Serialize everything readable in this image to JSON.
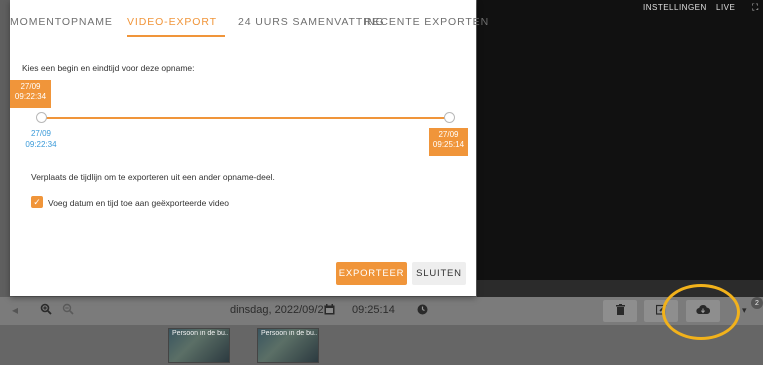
{
  "tabs": [
    {
      "label": "MOMENTOPNAME"
    },
    {
      "label": "VIDEO-EXPORT"
    },
    {
      "label": "24 UURS SAMENVATTING"
    },
    {
      "label": "RECENTE EXPORTEN"
    }
  ],
  "active_tab": "VIDEO-EXPORT",
  "dialog": {
    "prompt": "Kies een begin en eindtijd voor deze opname:",
    "start_tag_date": "27/09",
    "start_tag_time": "09:22:34",
    "start_blue_date": "27/09",
    "start_blue_time": "09:22:34",
    "end_tag_date": "27/09",
    "end_tag_time": "09:25:14",
    "hint": "Verplaats de tijdlijn om te exporteren uit een ander opname-deel.",
    "checkbox_label": "Voeg datum en tijd toe aan geëxporteerde video",
    "checkbox_checked": true,
    "export_button": "EXPORTEER",
    "close_button": "SLUITEN"
  },
  "video_strip": {
    "settings_label": "INSTELLINGEN",
    "live_label": "LIVE"
  },
  "toolbar": {
    "date": "dinsdag, 2022/09/27",
    "time": "09:25:14",
    "badge_count": "2"
  },
  "thumbnails": [
    {
      "label": "Persoon in de bu..."
    },
    {
      "label": "Persoon in de bu..."
    }
  ],
  "colors": {
    "accent": "#f0953a",
    "blue_text": "#3a9ad9",
    "highlight": "#f2b21b"
  }
}
